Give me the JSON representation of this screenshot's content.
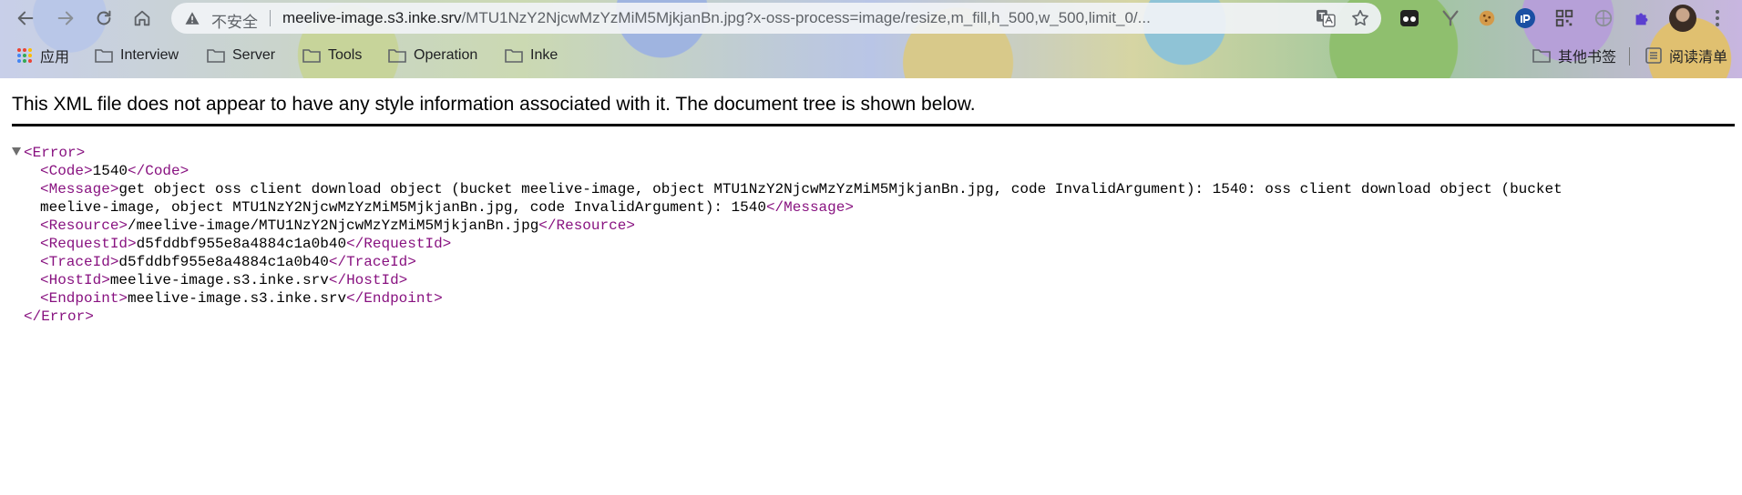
{
  "browser": {
    "not_secure_label": "不安全",
    "url_host": "meelive-image.s3.inke.srv",
    "url_path": "/MTU1NzY2NjcwMzYzMiM5MjkjanBn.jpg?x-oss-process=image/resize,m_fill,h_500,w_500,limit_0/...",
    "bookmarks": [
      "应用",
      "Interview",
      "Server",
      "Tools",
      "Operation",
      "Inke"
    ],
    "other_bookmarks": "其他书签",
    "reading_list": "阅读清单"
  },
  "page": {
    "notice": "This XML file does not appear to have any style information associated with it. The document tree is shown below."
  },
  "xml": {
    "root_open": "<Error>",
    "root_close": "</Error>",
    "code": {
      "open": "<Code>",
      "value": "1540",
      "close": "</Code>"
    },
    "message": {
      "open": "<Message>",
      "value_line1": "get object oss client download object (bucket meelive-image, object MTU1NzY2NjcwMzYzMiM5MjkjanBn.jpg, code InvalidArgument): 1540: oss client download object (bucket",
      "value_line2": "meelive-image, object MTU1NzY2NjcwMzYzMiM5MjkjanBn.jpg, code InvalidArgument): 1540",
      "close": "</Message>"
    },
    "resource": {
      "open": "<Resource>",
      "value": "/meelive-image/MTU1NzY2NjcwMzYzMiM5MjkjanBn.jpg",
      "close": "</Resource>"
    },
    "request_id": {
      "open": "<RequestId>",
      "value": "d5fddbf955e8a4884c1a0b40",
      "close": "</RequestId>"
    },
    "trace_id": {
      "open": "<TraceId>",
      "value": "d5fddbf955e8a4884c1a0b40",
      "close": "</TraceId>"
    },
    "host_id": {
      "open": "<HostId>",
      "value": "meelive-image.s3.inke.srv",
      "close": "</HostId>"
    },
    "endpoint": {
      "open": "<Endpoint>",
      "value": "meelive-image.s3.inke.srv",
      "close": "</Endpoint>"
    }
  },
  "colors": {
    "tag": "#881280",
    "text": "#000000",
    "chrome_icon": "#5f6368"
  },
  "icons": [
    "back-icon",
    "forward-icon",
    "reload-icon",
    "home-icon",
    "warning-icon",
    "translate-icon",
    "star-icon",
    "extension-icon",
    "cookie-icon",
    "qr-icon",
    "puzzle-icon",
    "folder-icon",
    "apps-grid-icon",
    "reading-list-icon",
    "menu-icon"
  ]
}
